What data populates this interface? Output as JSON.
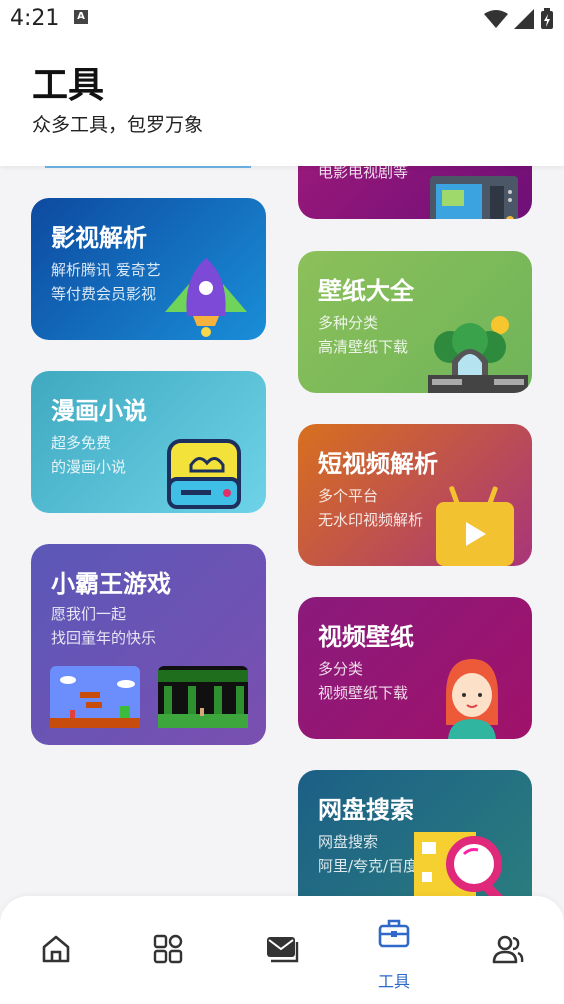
{
  "status": {
    "time": "4:21",
    "notification_letter": "A"
  },
  "header": {
    "title": "工具",
    "subtitle": "众多工具，包罗万象"
  },
  "cards": {
    "movies": {
      "desc1": "电影电视剧等"
    },
    "video_parse": {
      "title": "影视解析",
      "desc1": "解析腾讯 爱奇艺",
      "desc2": "等付费会员影视"
    },
    "wallpapers": {
      "title": "壁纸大全",
      "desc1": "多种分类",
      "desc2": "高清壁纸下载"
    },
    "comics": {
      "title": "漫画小说",
      "desc1": "超多免费",
      "desc2": "的漫画小说"
    },
    "short_video": {
      "title": "短视频解析",
      "desc1": "多个平台",
      "desc2": "无水印视频解析"
    },
    "nes_games": {
      "title": "小霸王游戏",
      "desc1": "愿我们一起",
      "desc2": "找回童年的快乐"
    },
    "video_wallpaper": {
      "title": "视频壁纸",
      "desc1": "多分类",
      "desc2": "视频壁纸下载"
    },
    "cloud_search": {
      "title": "网盘搜索",
      "desc1": "网盘搜索",
      "desc2": "阿里/夸克/百度"
    }
  },
  "nav": {
    "items": [
      {
        "icon": "home-icon",
        "label": ""
      },
      {
        "icon": "grid-icon",
        "label": ""
      },
      {
        "icon": "mail-icon",
        "label": ""
      },
      {
        "icon": "toolbox-icon",
        "label": "工具",
        "active": true
      },
      {
        "icon": "users-icon",
        "label": ""
      }
    ]
  },
  "colors": {
    "accent": "#2f68c9",
    "inactive": "#333333"
  }
}
